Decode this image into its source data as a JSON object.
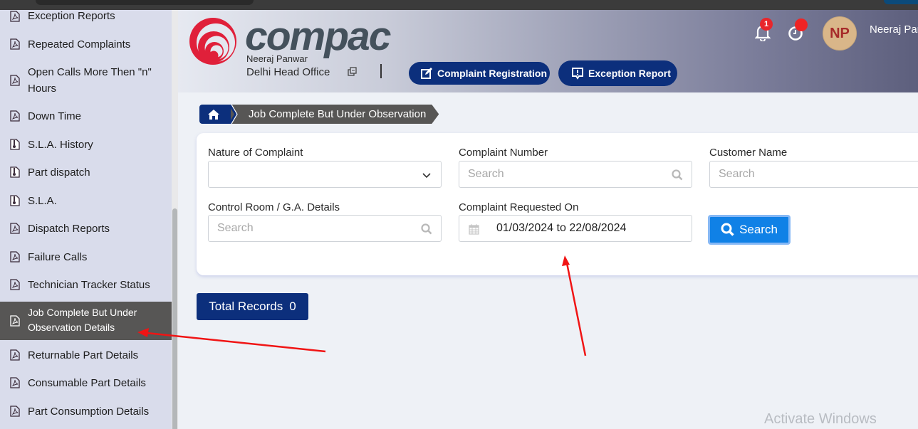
{
  "sidebar": {
    "items": [
      {
        "label": "Exception Reports",
        "icon": "pdf-file-icon"
      },
      {
        "label": "Repeated Complaints",
        "icon": "pdf-file-icon"
      },
      {
        "label": "Open Calls More Then \"n\" Hours",
        "icon": "pdf-file-icon"
      },
      {
        "label": "Down Time",
        "icon": "pdf-file-icon"
      },
      {
        "label": "S.L.A. History",
        "icon": "archive-file-icon"
      },
      {
        "label": "Part dispatch",
        "icon": "archive-file-icon"
      },
      {
        "label": "S.L.A.",
        "icon": "archive-file-icon"
      },
      {
        "label": "Dispatch Reports",
        "icon": "pdf-file-icon"
      },
      {
        "label": "Failure Calls",
        "icon": "pdf-file-icon"
      },
      {
        "label": "Technician Tracker Status",
        "icon": "pdf-file-icon"
      },
      {
        "label": "Job Complete But Under Observation Details",
        "icon": "pdf-file-icon",
        "active": true
      },
      {
        "label": "Returnable Part Details",
        "icon": "pdf-file-icon"
      },
      {
        "label": "Consumable Part Details",
        "icon": "pdf-file-icon"
      },
      {
        "label": "Part Consumption Details",
        "icon": "pdf-file-icon"
      }
    ]
  },
  "header": {
    "brand": "compac",
    "user_name": "Neeraj Panwar",
    "office": "Delhi Head Office",
    "buttons": {
      "complaint_registration": "Complaint Registration",
      "exception_report": "Exception Report"
    },
    "notifications_count": "1",
    "avatar_initials": "NP",
    "user_display": "Neeraj Panwar",
    "colors": {
      "primary": "#0c2f7c",
      "brand_red": "#e0203a",
      "badge_red": "#e8262b"
    }
  },
  "breadcrumb": {
    "home_icon": "home-icon",
    "current": "Job Complete But Under Observation"
  },
  "filters": {
    "nature_of_complaint": {
      "label": "Nature of Complaint",
      "value": ""
    },
    "complaint_number": {
      "label": "Complaint Number",
      "placeholder": "Search",
      "value": ""
    },
    "customer_name": {
      "label": "Customer Name",
      "placeholder": "Search",
      "value": ""
    },
    "control_room": {
      "label": "Control Room / G.A. Details",
      "placeholder": "Search",
      "value": ""
    },
    "requested_on": {
      "label": "Complaint Requested On",
      "value": "01/03/2024 to 22/08/2024"
    },
    "search_button": "Search"
  },
  "summary": {
    "total_records_label": "Total Records",
    "total_records_value": "0"
  },
  "os_watermark": "Activate Windows"
}
